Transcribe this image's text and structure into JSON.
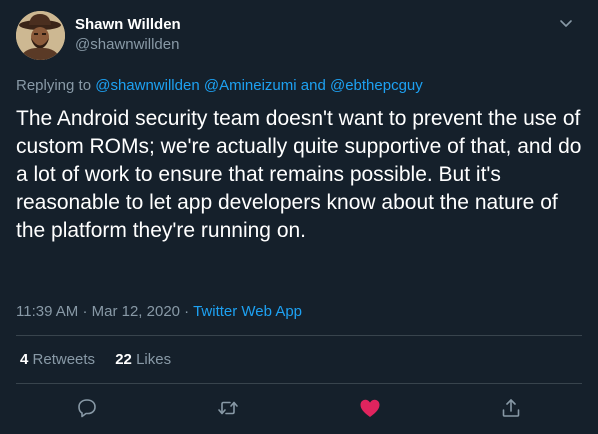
{
  "author": {
    "display_name": "Shawn Willden",
    "handle": "@shawnwillden"
  },
  "reply": {
    "prefix": "Replying to",
    "mention_1": "@shawnwillden",
    "mention_2": "@Amineizumi",
    "conjunction": "and",
    "mention_3": "@ebthepcguy"
  },
  "tweet": {
    "text": "The Android security team doesn't want to prevent the use of custom ROMs; we're actually quite supportive of that, and do a lot of work to ensure that remains possible.  But it's reasonable to let app developers know about the nature of the platform they're running on.",
    "time": "11:39 AM",
    "separator": "·",
    "date": "Mar 12, 2020",
    "source": "Twitter Web App"
  },
  "stats": {
    "retweets_count": "4",
    "retweets_label": "Retweets",
    "likes_count": "22",
    "likes_label": "Likes"
  },
  "icons": {
    "caret": "chevron-down-icon",
    "reply": "reply-icon",
    "retweet": "retweet-icon",
    "like": "heart-icon",
    "share": "share-icon"
  },
  "colors": {
    "background": "#15202b",
    "link": "#1da1f2",
    "secondary_text": "#8899a6",
    "like_active": "#e0245e",
    "divider": "#38444d"
  }
}
